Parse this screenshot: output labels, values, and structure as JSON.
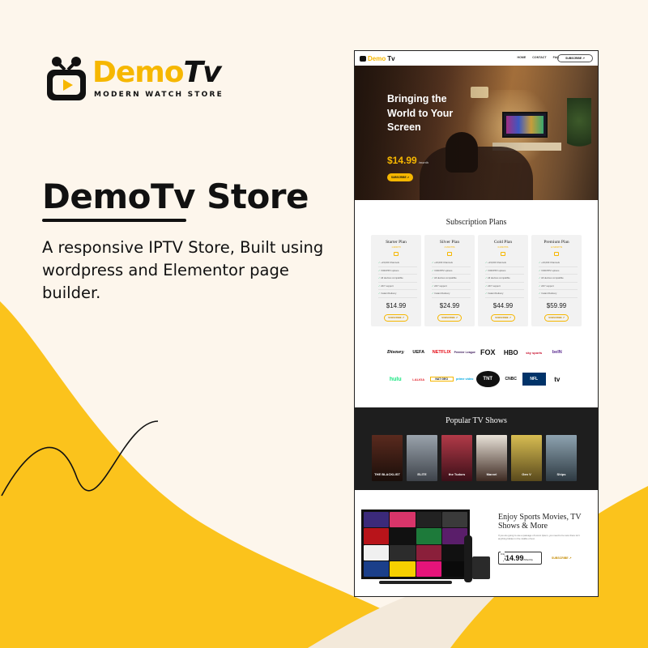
{
  "brand": {
    "logo_word_a": "Demo",
    "logo_word_b": "Tv",
    "tagline": "MODERN WATCH STORE",
    "accent_color": "#f6b700",
    "background_color": "#fdf6ec"
  },
  "headline": {
    "title": "DemoTv Store",
    "description": "A responsive IPTV Store, Built using wordpress and Elementor page builder."
  },
  "mockup": {
    "nav": {
      "logo_a": "Demo",
      "logo_b": "Tv",
      "links": [
        "HOME",
        "CONTACT",
        "FAQ"
      ],
      "subscribe": "SUBSCRIBE ↗"
    },
    "hero": {
      "title": "Bringing the World to Your Screen",
      "price": "$14.99",
      "price_suffix": "/month",
      "button": "SUBSCRIBE ↗"
    },
    "plans_title": "Subscription Plans",
    "plans": [
      {
        "name": "Starter Plan",
        "tag": "1 MONTH",
        "price": "$14.99",
        "button": "SUBSCRIBE ↗"
      },
      {
        "name": "Silver Plan",
        "tag": "3 MONTHS",
        "price": "$24.99",
        "button": "SUBSCRIBE ↗"
      },
      {
        "name": "Gold Plan",
        "tag": "6 MONTHS",
        "price": "$44.99",
        "button": "SUBSCRIBE ↗"
      },
      {
        "name": "Premium Plan",
        "tag": "12 MONTHS",
        "price": "$59.99",
        "button": "SUBSCRIBE ↗"
      }
    ],
    "plan_features": [
      "+23,000 Channels",
      "VOD/PPV options",
      "All devices compatible",
      "24/7 support",
      "Instant Delivery"
    ],
    "channel_logos_row1": [
      "Disney",
      "UEFA",
      "NETFLIX",
      "Premier League",
      "FOX",
      "HBO",
      "sky sports",
      "beIN"
    ],
    "channel_logos_row2": [
      "hulu",
      "LALIGA",
      "NAT GEO",
      "prime video",
      "TNT",
      "CNBC",
      "NFL",
      "tv"
    ],
    "shows_title": "Popular TV Shows",
    "shows": [
      {
        "title": "THE BLACKLIST",
        "color": "#3a1a14"
      },
      {
        "title": "ELITE",
        "color": "#6a6f78"
      },
      {
        "title": "the Tudors",
        "color": "#7a2434"
      },
      {
        "title": "Marvel",
        "color": "#3d2a22"
      },
      {
        "title": "Gen V",
        "color": "#a08a3c"
      },
      {
        "title": "Ships",
        "color": "#4a5a66"
      }
    ],
    "promo": {
      "title": "Enjoy Sports Movies, TV Shows & More",
      "text": "If you are going to use a passage of Lorem Ipsum, you need to be sure there isn't anything hidden in the middle of text.",
      "price_label": "Only",
      "price": "$14.99",
      "price_suffix": "/Monthly",
      "link": "SUBSCRIBE ↗"
    }
  }
}
